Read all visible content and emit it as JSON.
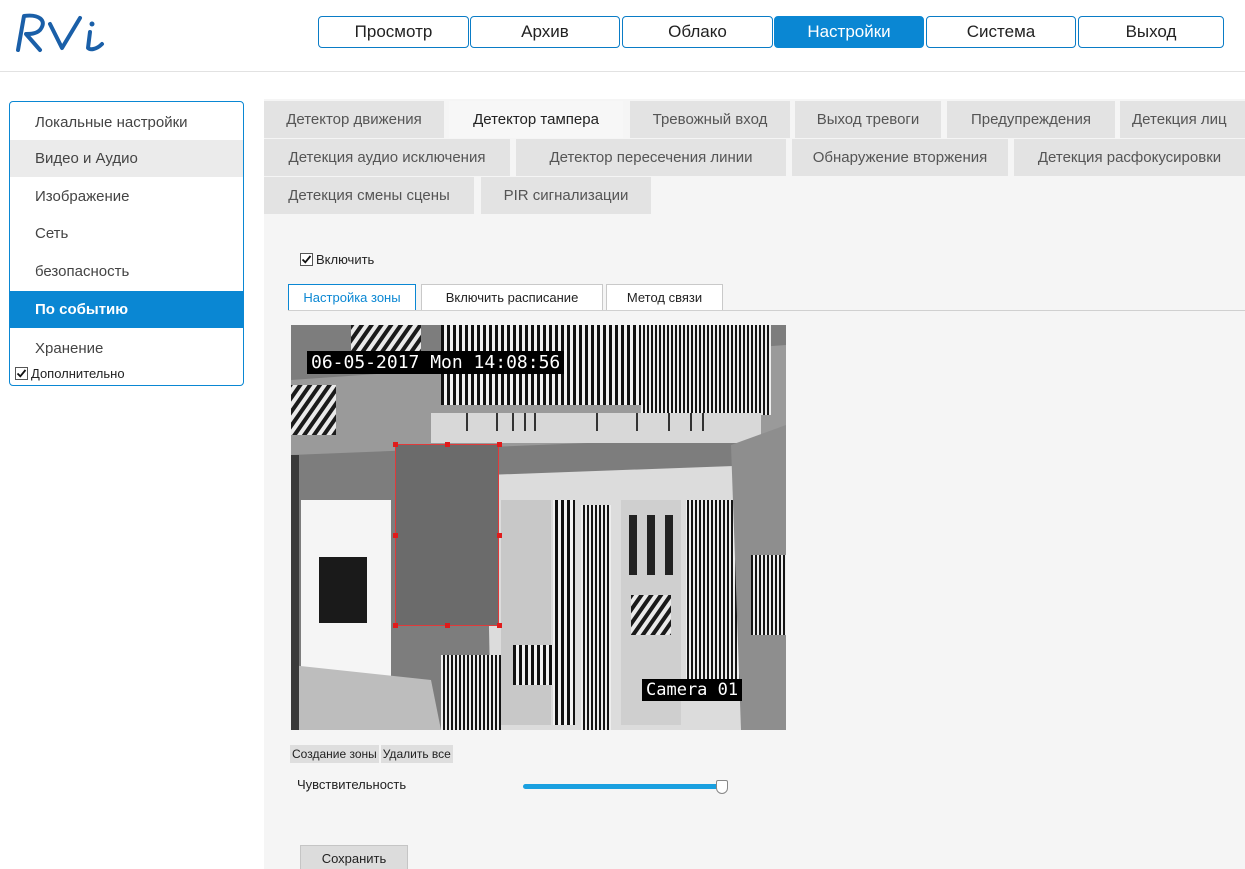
{
  "brand": {
    "logo_text": "RVi",
    "accent": "#0a87d3"
  },
  "topnav": {
    "items": [
      {
        "label": "Просмотр"
      },
      {
        "label": "Архив"
      },
      {
        "label": "Облако"
      },
      {
        "label": "Настройки",
        "active": true
      },
      {
        "label": "Система"
      },
      {
        "label": "Выход"
      }
    ]
  },
  "sidebar": {
    "items": [
      {
        "label": "Локальные настройки"
      },
      {
        "label": "Видео и Аудио"
      },
      {
        "label": "Изображение"
      },
      {
        "label": "Сеть"
      },
      {
        "label": "безопасность"
      },
      {
        "label": "По событию",
        "active": true
      },
      {
        "label": "Хранение"
      }
    ],
    "extra_label": "Дополнительно",
    "extra_checked": true
  },
  "tabs": {
    "row1": [
      "Детектор движения",
      "Детектор тампера",
      "Тревожный вход",
      "Выход тревоги",
      "Предупреждения",
      "Детекция лиц"
    ],
    "row2": [
      "Детекция аудио исключения",
      "Детектор пересечения линии",
      "Обнаружение вторжения",
      "Детекция расфокусировки"
    ],
    "row3": [
      "Детекция смены сцены",
      "PIR сигнализации"
    ],
    "active": "Детектор тампера"
  },
  "enable": {
    "label": "Включить",
    "checked": true
  },
  "subtabs": {
    "items": [
      "Настройка зоны",
      "Включить расписание",
      "Метод связи"
    ],
    "active": "Настройка зоны"
  },
  "video": {
    "osd_time": "06-05-2017 Mon 14:08:56",
    "osd_camera": "Camera 01"
  },
  "zone_controls": {
    "create": "Создание зоны",
    "delete_all": "Удалить все"
  },
  "sensitivity": {
    "label": "Чувствительность",
    "value_percent": 97
  },
  "save_label": "Сохранить"
}
